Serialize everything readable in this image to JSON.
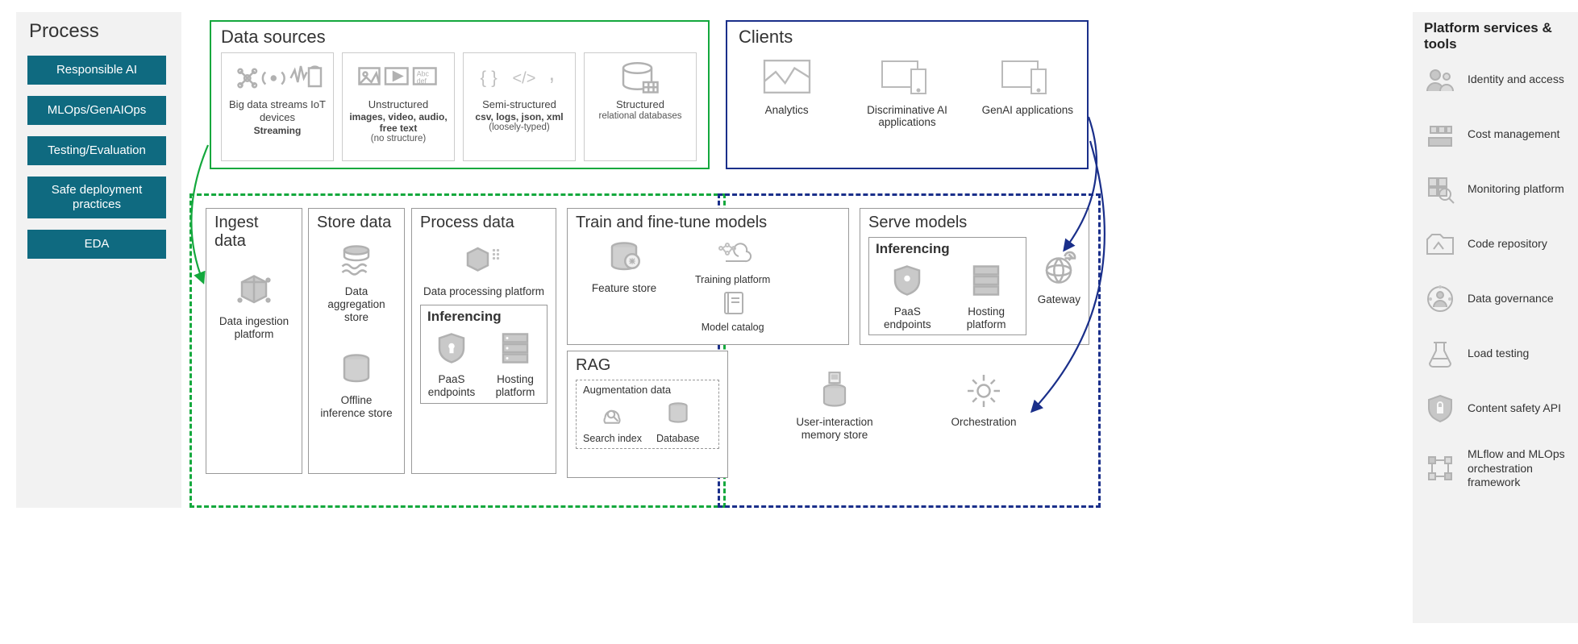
{
  "process": {
    "title": "Process",
    "buttons": [
      "Responsible AI",
      "MLOps/GenAIOps",
      "Testing/Evaluation",
      "Safe deployment practices",
      "EDA"
    ]
  },
  "data_sources": {
    "title": "Data sources",
    "items": [
      {
        "label": "Big data streams IoT devices",
        "sub": "Streaming",
        "note": ""
      },
      {
        "label": "Unstructured",
        "sub": "images, video, audio, free text",
        "note": "(no structure)"
      },
      {
        "label": "Semi-structured",
        "sub": "csv, logs, json, xml",
        "note": "(loosely-typed)"
      },
      {
        "label": "Structured",
        "sub": "",
        "note": "relational databases"
      }
    ]
  },
  "clients": {
    "title": "Clients",
    "items": [
      "Analytics",
      "Discriminative AI applications",
      "GenAI applications"
    ]
  },
  "core": {
    "ingest": {
      "title": "Ingest data",
      "node": "Data ingestion platform"
    },
    "store": {
      "title": "Store data",
      "nodes": [
        "Data aggregation store",
        "Offline inference store"
      ]
    },
    "process": {
      "title": "Process data",
      "node": "Data processing platform",
      "inferencing": {
        "title": "Inferencing",
        "nodes": [
          "PaaS endpoints",
          "Hosting platform"
        ]
      }
    },
    "train": {
      "title": "Train and fine-tune models",
      "nodes": [
        "Feature store",
        "Training platform",
        "Model catalog"
      ]
    },
    "serve": {
      "title": "Serve models",
      "inferencing": {
        "title": "Inferencing",
        "nodes": [
          "PaaS endpoints",
          "Hosting platform"
        ]
      },
      "gateway": "Gateway"
    },
    "rag": {
      "title": "RAG",
      "aug_title": "Augmentation data",
      "nodes": [
        "Search index",
        "Database"
      ]
    },
    "uim": "User-interaction memory store",
    "orch": "Orchestration"
  },
  "platform": {
    "title": "Platform services & tools",
    "items": [
      "Identity and access",
      "Cost management",
      "Monitoring platform",
      "Code repository",
      "Data governance",
      "Load testing",
      "Content safety API",
      "MLflow and MLOps orchestration framework"
    ]
  }
}
